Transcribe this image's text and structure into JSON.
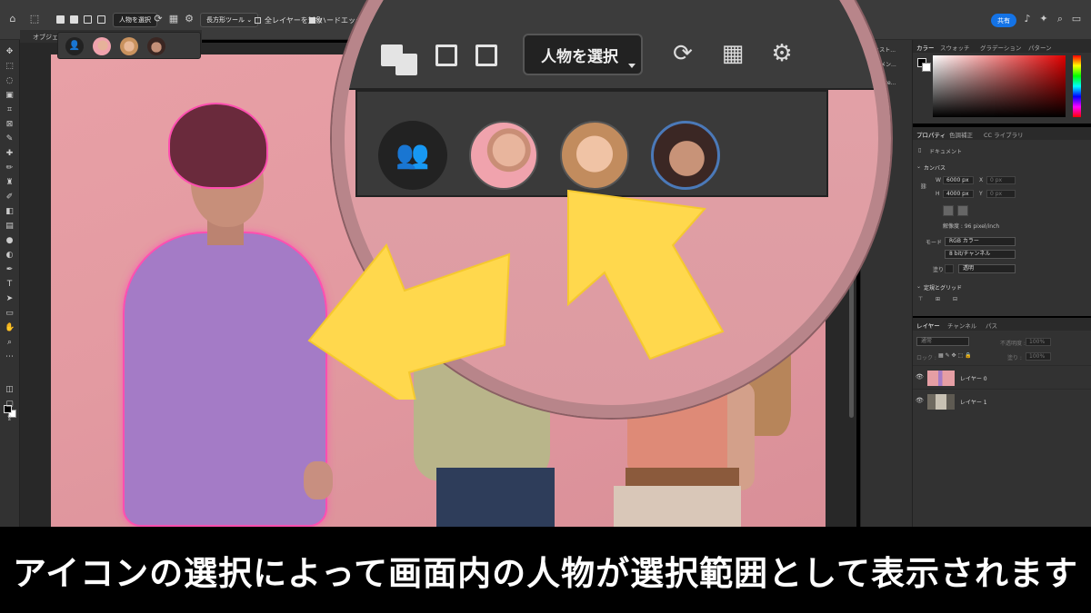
{
  "options_bar": {
    "select_subject_label": "人物を選択",
    "tool_mode_dropdown": "長方形ツール",
    "sample_all_layers_label": "全レイヤーを対象",
    "hard_edge_label": "ハードエッジ",
    "share_button": "共有"
  },
  "document": {
    "tab_title": "オブジェ..."
  },
  "person_flyout": {
    "items": [
      {
        "name": "all-people",
        "icon": "people-icon"
      },
      {
        "name": "person-1",
        "icon": "avatar"
      },
      {
        "name": "person-2",
        "icon": "avatar"
      },
      {
        "name": "person-3",
        "icon": "avatar"
      }
    ]
  },
  "side_strip": {
    "items": [
      "ヒスト...",
      "コメン...",
      "Conte..."
    ]
  },
  "color_panel": {
    "tabs": [
      "カラー",
      "スウォッチ",
      "グラデーション",
      "パターン"
    ]
  },
  "properties_panel": {
    "tabs": [
      "プロパティ",
      "色調補正",
      "CC ライブラリ"
    ],
    "doc_label": "ドキュメント",
    "canvas_section": "カンバス",
    "width_label": "W",
    "width_value": "6000 px",
    "height_label": "H",
    "height_value": "4000 px",
    "x_label": "X",
    "y_label": "Y",
    "x_value": "0 px",
    "y_value": "0 px",
    "resolution": "解像度 : 96 pixel/inch",
    "mode_label": "モード",
    "mode_value": "RGB カラー",
    "bit_value": "8 bit/チャンネル",
    "fill_label": "塗り",
    "fill_value": "透明",
    "guides_section": "定規とグリッド"
  },
  "layers_panel": {
    "tabs": [
      "レイヤー",
      "チャンネル",
      "パス"
    ],
    "kind_label": "通常",
    "opacity_label": "不透明度 :",
    "opacity_value": "100%",
    "lock_label": "ロック :",
    "fill_label": "塗り :",
    "fill_value": "100%",
    "layers": [
      {
        "name": "レイヤー 0",
        "visible": true
      },
      {
        "name": "レイヤー 1",
        "visible": true
      }
    ]
  },
  "magnifier": {
    "select_subject_label": "人物を選択"
  },
  "caption": "アイコンの選択によって画面内の人物が選択範囲として表示されます",
  "colors": {
    "accent_share": "#1473e6",
    "arrow_yellow": "#ffd84d",
    "selection_outline": "#ff4fb0",
    "magnifier_ring": "#b8858a"
  }
}
